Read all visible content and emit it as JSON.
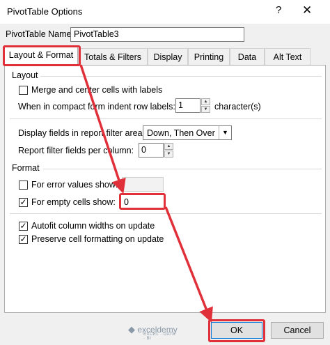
{
  "dialog": {
    "title": "PivotTable Options",
    "help_icon": "?",
    "close_icon": "✕"
  },
  "name_field": {
    "label": "PivotTable Name:",
    "value": "PivotTable3"
  },
  "tabs": [
    {
      "label": "Layout & Format",
      "active": true
    },
    {
      "label": "Totals & Filters"
    },
    {
      "label": "Display"
    },
    {
      "label": "Printing"
    },
    {
      "label": "Data"
    },
    {
      "label": "Alt Text"
    }
  ],
  "layout": {
    "heading": "Layout",
    "merge_label": "Merge and center cells with labels",
    "merge_checked": false,
    "indent_label": "When in compact form indent row labels:",
    "indent_value": "1",
    "indent_unit": "character(s)",
    "display_fields_label": "Display fields in report filter area:",
    "display_fields_value": "Down, Then Over",
    "filter_fields_label": "Report filter fields per column:",
    "filter_fields_value": "0"
  },
  "format": {
    "heading": "Format",
    "error_label": "For error values show:",
    "error_checked": false,
    "error_value": "",
    "empty_label": "For empty cells show:",
    "empty_checked": true,
    "empty_value": "0",
    "autofit_label": "Autofit column widths on update",
    "autofit_checked": true,
    "preserve_label": "Preserve cell formatting on update",
    "preserve_checked": true
  },
  "buttons": {
    "ok": "OK",
    "cancel": "Cancel"
  },
  "watermark": {
    "brand": "exceldemy",
    "tagline": "EXCEL · DATA · BI"
  },
  "annotation_color": "#e0303a"
}
